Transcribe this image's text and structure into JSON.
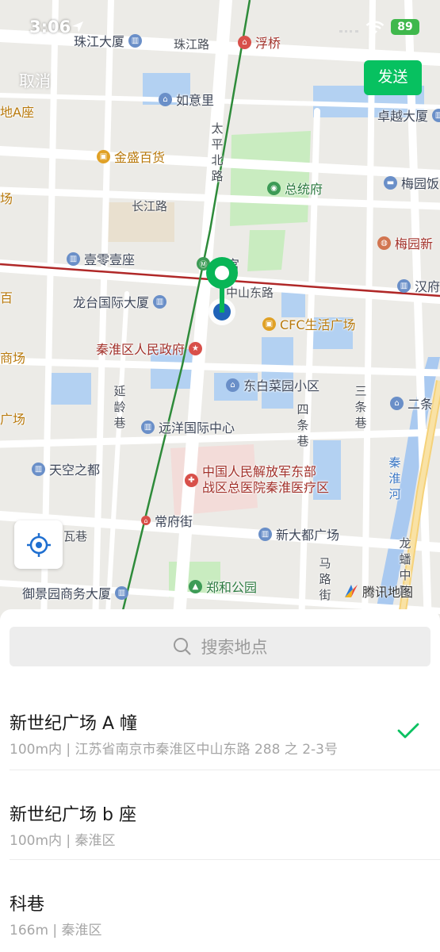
{
  "status_bar": {
    "time": "3:06",
    "battery": "89"
  },
  "header": {
    "cancel": "取消",
    "send": "发送"
  },
  "map": {
    "roads": {
      "zhujiang": "珠江路",
      "changjiang": "长江路",
      "zhongshandong": "中山东路",
      "taiping": "太平北路",
      "yanling": "延龄巷",
      "sitiao": "四条巷",
      "santiao": "三条巷",
      "majia": "马路街",
      "longpan": "龙蟠中路",
      "wa": "瓦巷",
      "changfu": "常府街",
      "qinhuai_river": "秦淮河"
    },
    "pois": {
      "zhujiang_tower": "珠江大厦",
      "fuqiao": "浮桥",
      "ruyili": "如意里",
      "zhuoyue": "卓越大厦",
      "jinsheng": "金盛百货",
      "zongtongfu": "总统府",
      "meiyuan_fan": "梅园饭",
      "yilingyi": "壹零壹座",
      "meiyuan_new": "梅园新",
      "xinggong": "行宫",
      "hanfu": "汉府",
      "longtai": "龙台国际大厦",
      "cfc": "CFC生活广场",
      "qinhuai_gov": "秦淮区人民政府",
      "dongbai": "东白菜园小区",
      "ertiao": "二条",
      "yuanyang": "远洋国际中心",
      "tiankong": "天空之都",
      "hospital_line1": "中国人民解放军东部",
      "hospital_line2": "战区总医院秦淮医疗区",
      "xindadu": "新大都广场",
      "yujingyuan": "御景园商务大厦",
      "zhenghe": "郑和公园",
      "left_a": "地A座",
      "left_chang": "场",
      "left_bai": "百",
      "left_shang": "商场",
      "left_guang": "广场"
    },
    "brand": "腾讯地图"
  },
  "search": {
    "placeholder": "搜索地点"
  },
  "results": [
    {
      "name": "新世纪广场 A 幢",
      "address": "100m内 | 江苏省南京市秦淮区中山东路 288 之 2-3号",
      "selected": true
    },
    {
      "name": "新世纪广场 b 座",
      "address": "100m内 | 秦淮区",
      "selected": false
    },
    {
      "name": "科巷",
      "address": "166m | 秦淮区",
      "selected": false
    }
  ],
  "colors": {
    "accent": "#07c160",
    "pin_green": "#08b556",
    "pin_dot": "#1f63b8",
    "metro_line": "#2e8b3a",
    "rail_line": "#b02828"
  }
}
